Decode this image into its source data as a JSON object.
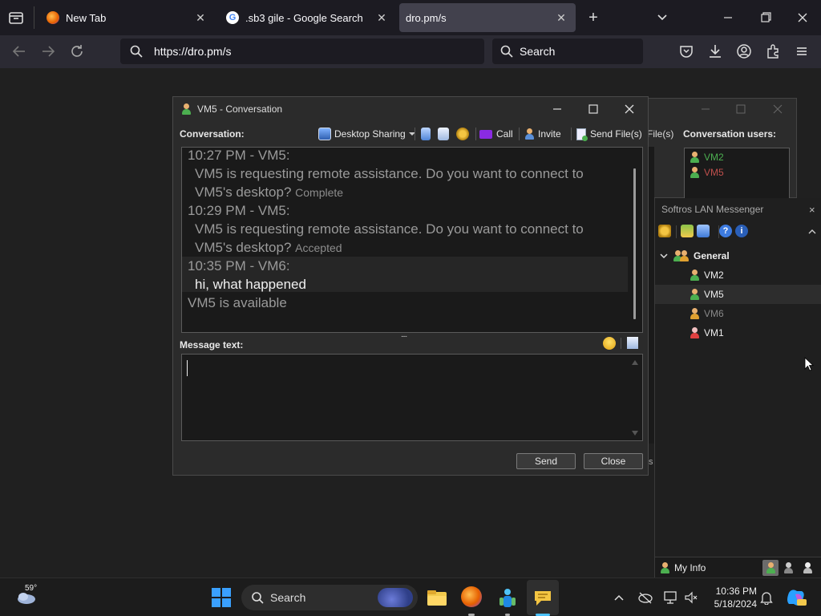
{
  "browser": {
    "tabs": [
      {
        "title": "New Tab"
      },
      {
        "title": ".sb3 gile - Google Search"
      },
      {
        "title": "dro.pm/s"
      }
    ],
    "new_tab_symbol": "+",
    "url": "https://dro.pm/s",
    "search_placeholder": "Search"
  },
  "background_dialog": {
    "send_files_fragment": "File(s)",
    "conversation_users_label": "Conversation users:",
    "users": [
      {
        "name": "VM2",
        "color": "#4caf50"
      },
      {
        "name": "VM5",
        "color": "#c0504d"
      }
    ],
    "bottom_fragment": "s"
  },
  "messenger": {
    "title": "Softros LAN Messenger",
    "close_symbol": "×",
    "group": "General",
    "contacts": [
      {
        "name": "VM2",
        "status": "online"
      },
      {
        "name": "VM5",
        "status": "online"
      },
      {
        "name": "VM6",
        "status": "away"
      },
      {
        "name": "VM1",
        "status": "offline"
      }
    ],
    "my_info": "My Info"
  },
  "conversation": {
    "title": "VM5 - Conversation",
    "conversation_label": "Conversation:",
    "toolbar": {
      "desktop_sharing": "Desktop Sharing",
      "call": "Call",
      "invite": "Invite",
      "send_files": "Send File(s)"
    },
    "history": [
      {
        "header": "10:27 PM - VM5:",
        "line1": "VM5 is requesting remote assistance. Do you want to connect to",
        "line2": "VM5's desktop?",
        "status": "Complete"
      },
      {
        "header": "10:29 PM - VM5:",
        "line1": "VM5 is requesting remote assistance. Do you want to connect to",
        "line2": "VM5's desktop?",
        "status": "Accepted"
      },
      {
        "header": "10:35 PM - VM6:",
        "line1": "hi, what happened"
      }
    ],
    "system_message": "VM5 is available",
    "splitter": "....",
    "message_label": "Message text:",
    "message_value": "",
    "send_label": "Send",
    "close_label": "Close"
  },
  "taskbar": {
    "weather_temp": "59°",
    "search_label": "Search",
    "time": "10:36 PM",
    "date": "5/18/2024"
  }
}
